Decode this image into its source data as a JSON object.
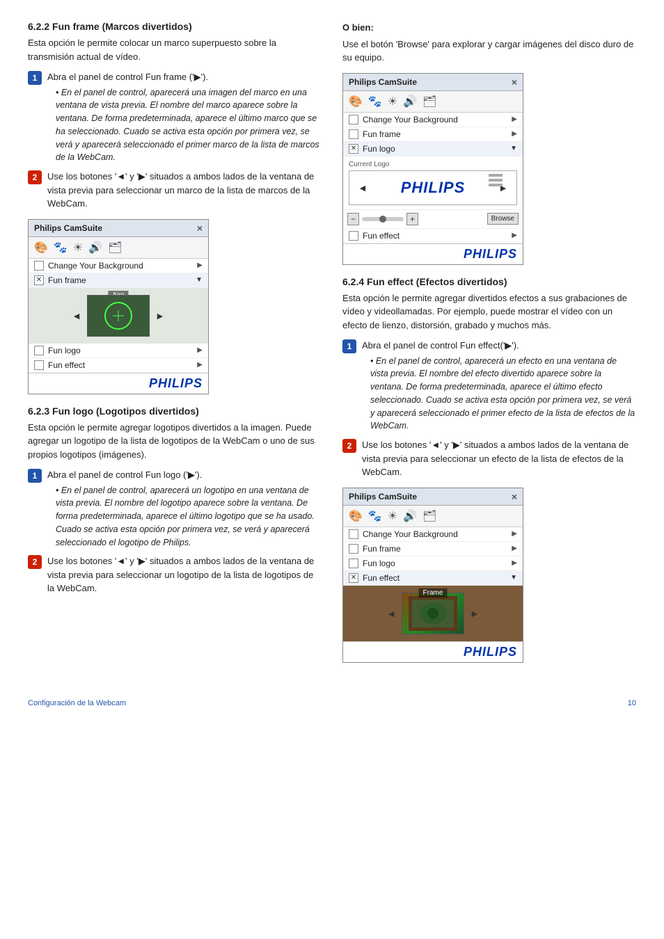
{
  "sections": {
    "s622": {
      "title": "6.2.2   Fun frame (Marcos divertidos)",
      "intro": "Esta opción le permite colocar un marco superpuesto sobre la transmisión actual de vídeo.",
      "step1_text": "Abra el panel de control Fun frame ('▶').",
      "step1_note": "• En el panel de control, aparecerá una imagen del marco en una ventana de vista previa. El nombre del marco aparece sobre la ventana. De forma predeterminada, aparece el último marco que se ha seleccionado. Cuado se activa esta opción por primera vez, se verá y aparecerá seleccionado el primer marco de la lista de marcos de la WebCam.",
      "step2_text": "Use los botones '◄' y '▶' situados a ambos lados de la ventana de vista previa para seleccionar un marco de la lista de marcos de la WebCam."
    },
    "s623": {
      "title": "6.2.3   Fun logo (Logotipos divertidos)",
      "intro": "Esta opción le permite agregar logotipos divertidos a la imagen. Puede agregar un logotipo de la lista de logotipos de la WebCam o uno de sus propios logotipos (imágenes).",
      "step1_text": "Abra el panel de control Fun logo ('▶').",
      "step1_note": "• En el panel de control, aparecerá un logotipo en una ventana de vista previa. El nombre del logotipo aparece sobre la ventana. De forma predeterminada, aparece el último logotipo que se ha usado. Cuado se activa esta opción por primera vez, se verá y aparecerá seleccionado el logotipo de Philips.",
      "step2_text": "Use los botones '◄' y '▶' situados a ambos lados de la ventana de vista previa para seleccionar un logotipo de la lista de logotipos de la WebCam."
    },
    "o_bien": {
      "title": "O bien:",
      "text": "Use el botón 'Browse' para explorar y cargar imágenes del disco duro de su equipo."
    },
    "s624": {
      "title": "6.2.4   Fun effect (Efectos divertidos)",
      "intro": "Esta opción le permite agregar divertidos efectos a sus grabaciones de vídeo y videollamadas. Por ejemplo, puede mostrar el vídeo con un efecto de lienzo, distorsión, grabado y muchos más.",
      "step1_text": "Abra el panel de control Fun effect('▶').",
      "step1_note": "• En el panel de control, aparecerá un efecto en una ventana de vista previa. El nombre del efecto divertido aparece sobre la ventana. De forma predeterminada, aparece el último efecto seleccionado. Cuado se activa esta opción por primera vez, se verá y aparecerá seleccionado el primer efecto de la lista de efectos de la WebCam.",
      "step2_text": "Use los botones '◄' y '▶' situados a ambos lados de la ventana de vista previa para seleccionar un efecto de la lista de efectos de la WebCam."
    }
  },
  "cam_windows": {
    "win622": {
      "title": "Philips CamSuite",
      "close": "×",
      "menu_items": [
        {
          "label": "Change Your Background",
          "checked": false,
          "expanded": false
        },
        {
          "label": "Fun frame",
          "checked": true,
          "expanded": true
        },
        {
          "label": "Fun logo",
          "checked": false,
          "expanded": false
        },
        {
          "label": "Fun effect",
          "checked": false,
          "expanded": false
        }
      ],
      "preview_label": "Aim",
      "philips_logo": "PHILIPS"
    },
    "win623": {
      "title": "Philips CamSuite",
      "close": "×",
      "menu_items": [
        {
          "label": "Change Your Background",
          "checked": false,
          "expanded": false
        },
        {
          "label": "Fun frame",
          "checked": false,
          "expanded": false
        },
        {
          "label": "Fun logo",
          "checked": true,
          "expanded": true
        },
        {
          "label": "Fun effect",
          "checked": false,
          "expanded": false
        }
      ],
      "current_logo_label": "Current Logo",
      "logo_nav_minus": "−",
      "logo_nav_plus": "+",
      "browse_label": "Browse",
      "philips_logo": "PHILIPS"
    },
    "win624": {
      "title": "Philips CamSuite",
      "close": "×",
      "menu_items": [
        {
          "label": "Change Your Background",
          "checked": false,
          "expanded": false
        },
        {
          "label": "Fun frame",
          "checked": false,
          "expanded": false
        },
        {
          "label": "Fun logo",
          "checked": false,
          "expanded": false
        },
        {
          "label": "Fun effect",
          "checked": true,
          "expanded": true
        }
      ],
      "preview_label": "Frame",
      "philips_logo": "PHILIPS"
    }
  },
  "footer": {
    "left": "Configuración de la Webcam",
    "page": "10"
  },
  "toolbar_icons": [
    "🎨",
    "🐾",
    "☀",
    "🔊",
    "🗂"
  ]
}
